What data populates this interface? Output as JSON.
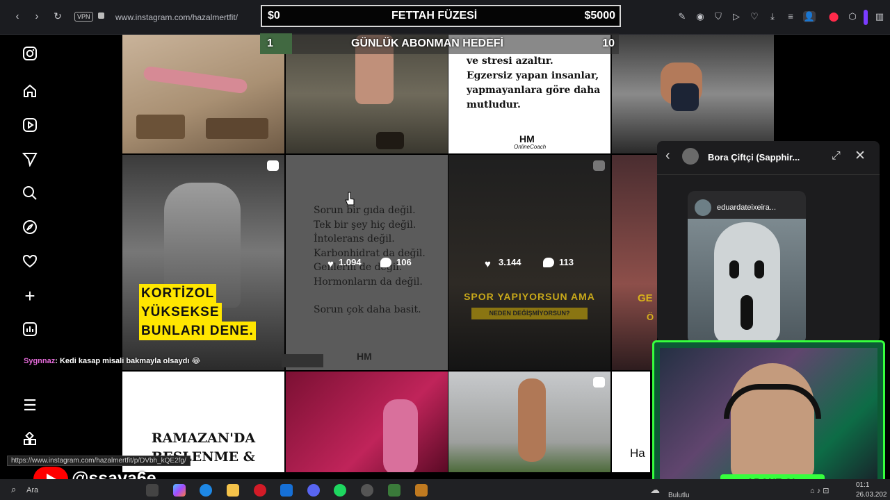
{
  "browser": {
    "vpn_label": "VPN",
    "url": "www.instagram.com/hazalmertfit/"
  },
  "overlay": {
    "donation_current": "$0",
    "donation_title": "FETTAH FÜZESİ",
    "donation_goal": "$5000",
    "sub_current": "1",
    "sub_title": "GÜNLÜK ABONMAN HEDEFİ",
    "sub_goal": "10",
    "chat_user": "Sygnnaz",
    "chat_message": ": Kedi kasap misali bakmayla olsaydı 😂",
    "status_url": "https://www.instagram.com/hazalmertfit/p/DVbh_kQE2fg/",
    "youtube_handle": "@ssava6e",
    "subscribe_banner": "ABONE OL"
  },
  "posts": {
    "quote_lines": [
      "ve stresi azaltır.",
      "Egzersiz yapan insanlar,",
      "yapmayanlara göre daha",
      "mutludur."
    ],
    "hm_logo": "HM",
    "hm_sub": "OnlineCoach",
    "kortizol_lines": [
      "KORTİZOL",
      "YÜKSEKSE",
      "BUNLARI DENE."
    ],
    "sorun_lines": [
      "Sorun bir gıda değil.",
      "Tek bir şey hiç değil.",
      "",
      "İntolerans değil.",
      "Karbonhidrat da değil.",
      "Genlerin de değil.",
      "Hormonların da değil.",
      "",
      "Sorun çok daha basit."
    ],
    "hover_likes": "1.094",
    "hover_comments": "106",
    "spor_likes": "3.144",
    "spor_comments": "113",
    "spor_title": "SPOR YAPIYORSUN AMA",
    "spor_sub": "NEDEN DEĞİŞMİYORSUN?",
    "partial_title": "GE",
    "partial_title2": "Ö",
    "ramazan_lines": [
      "RAMAZAN'DA",
      "BESLENME &"
    ],
    "partial_text": "Ha"
  },
  "dm": {
    "name": "Bora Çiftçi (Sapphir...",
    "shared_user": "eduardateixeira..."
  },
  "taskbar": {
    "search": "Ara",
    "weather": "Bulutlu",
    "time": "01:1",
    "date": "26.03.202"
  }
}
